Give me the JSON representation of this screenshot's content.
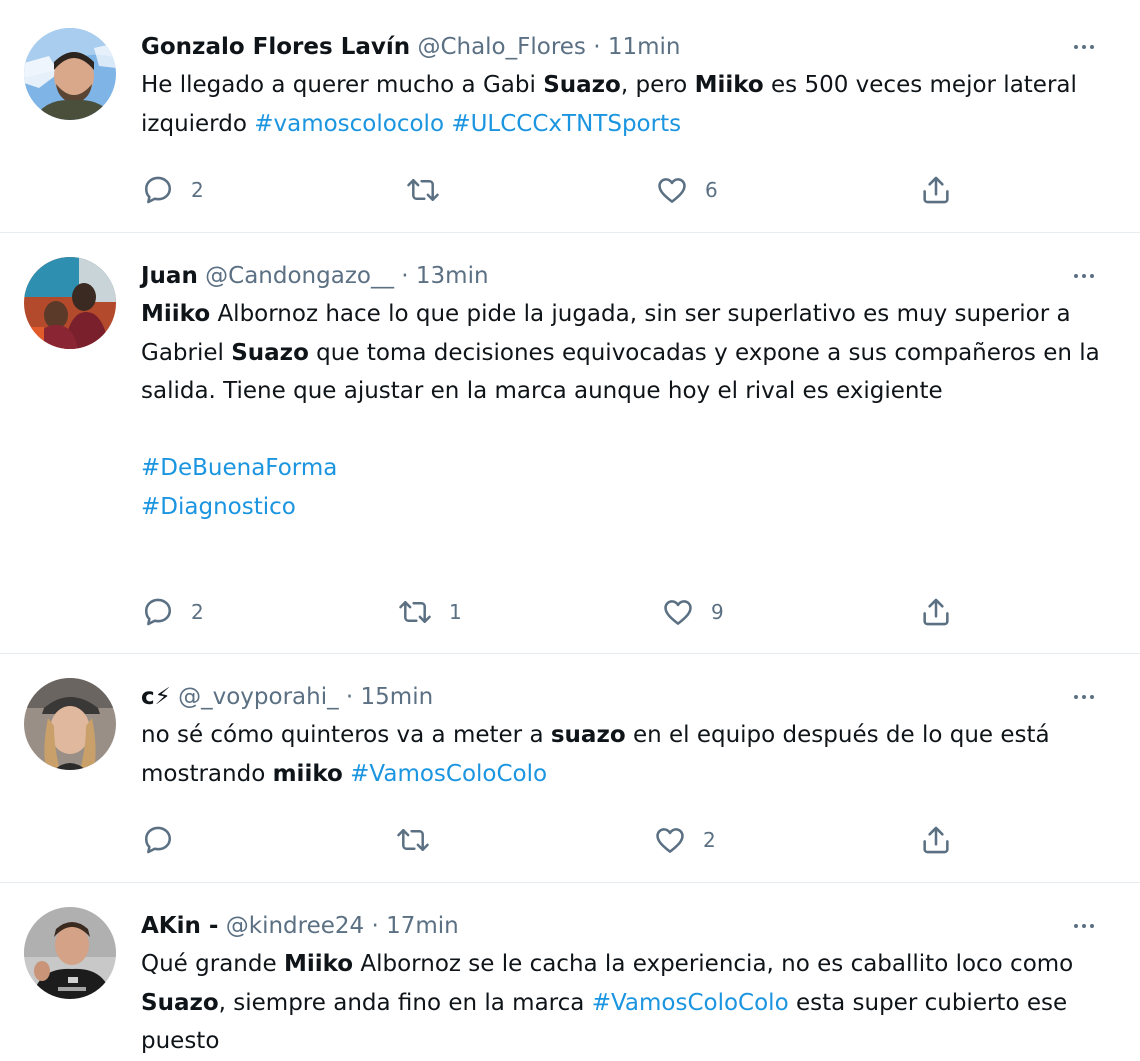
{
  "tweets": [
    {
      "name": "Gonzalo Flores Lavín",
      "handle": "@Chalo_Flores",
      "dot": "·",
      "time": "11min",
      "text": [
        {
          "t": "He llegado a querer mucho a Gabi "
        },
        {
          "b": "Suazo"
        },
        {
          "t": ", pero "
        },
        {
          "b": "Miiko"
        },
        {
          "t": " es 500 veces mejor lateral izquierdo "
        },
        {
          "h": "#vamoscolocolo"
        },
        {
          "t": " "
        },
        {
          "h": "#ULCCCxTNTSports"
        }
      ],
      "replies": "2",
      "retweets": "",
      "likes": "6"
    },
    {
      "name": "Juan",
      "handle": "@Candongazo__",
      "dot": "·",
      "time": "13min",
      "text": [
        {
          "b": "Miiko"
        },
        {
          "t": " Albornoz hace lo que pide la jugada, sin ser superlativo es muy superior a Gabriel "
        },
        {
          "b": "Suazo"
        },
        {
          "t": " que toma decisiones equivocadas y expone a sus compañeros en la salida. Tiene que ajustar en la marca aunque hoy el rival es exigiente"
        },
        {
          "br": true
        },
        {
          "br": true
        },
        {
          "h": "#DeBuenaForma"
        },
        {
          "br": true
        },
        {
          "h": "#Diagnostico"
        }
      ],
      "replies": "2",
      "retweets": "1",
      "likes": "9"
    },
    {
      "name": "c⚡",
      "handle": "@_voyporahi_",
      "dot": "·",
      "time": "15min",
      "text": [
        {
          "t": "no sé cómo quinteros va a meter a "
        },
        {
          "b": "suazo"
        },
        {
          "t": " en el equipo después de lo que está mostrando "
        },
        {
          "b": "miiko"
        },
        {
          "t": " "
        },
        {
          "h": "#VamosColoColo"
        }
      ],
      "replies": "",
      "retweets": "",
      "likes": "2"
    },
    {
      "name": "AKin -",
      "handle": "@kindree24",
      "dot": "·",
      "time": "17min",
      "text": [
        {
          "t": "Qué grande "
        },
        {
          "b": "Miiko"
        },
        {
          "t": " Albornoz se le cacha la experiencia, no es caballito loco como "
        },
        {
          "b": "Suazo"
        },
        {
          "t": ", siempre anda fino en la marca "
        },
        {
          "h": "#VamosColoColo"
        },
        {
          "t": " esta super cubierto ese puesto"
        }
      ],
      "replies": "",
      "retweets": "",
      "likes": ""
    }
  ],
  "icons": {
    "reply": "reply-icon",
    "retweet": "retweet-icon",
    "like": "like-icon",
    "share": "share-icon",
    "more": "more-icon"
  },
  "colors": {
    "hashtag": "#1b95e0",
    "muted": "#5b7083",
    "text": "#0f1419",
    "divider": "#e6ecf0"
  }
}
